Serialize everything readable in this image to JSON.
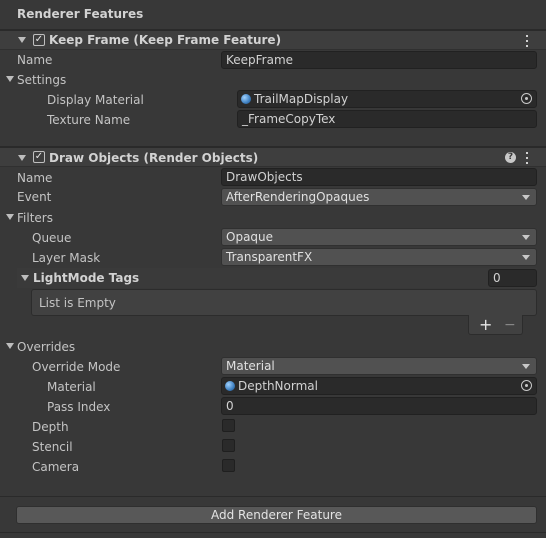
{
  "panel": {
    "title": "Renderer Features"
  },
  "keep_frame": {
    "title": "Keep Frame (Keep Frame Feature)",
    "enabled": true,
    "name_label": "Name",
    "name_value": "KeepFrame",
    "settings_label": "Settings",
    "display_material_label": "Display Material",
    "display_material_value": "TrailMapDisplay",
    "texture_name_label": "Texture Name",
    "texture_name_value": "_FrameCopyTex"
  },
  "draw_objects": {
    "title": "Draw Objects (Render Objects)",
    "enabled": true,
    "name_label": "Name",
    "name_value": "DrawObjects",
    "event_label": "Event",
    "event_value": "AfterRenderingOpaques",
    "filters_label": "Filters",
    "queue_label": "Queue",
    "queue_value": "Opaque",
    "layer_mask_label": "Layer Mask",
    "layer_mask_value": "TransparentFX",
    "lightmode_label": "LightMode Tags",
    "lightmode_count": "0",
    "list_empty": "List is Empty",
    "add_symbol": "+",
    "remove_symbol": "−",
    "overrides_label": "Overrides",
    "override_mode_label": "Override Mode",
    "override_mode_value": "Material",
    "material_label": "Material",
    "material_value": "DepthNormal",
    "pass_index_label": "Pass Index",
    "pass_index_value": "0",
    "depth_label": "Depth",
    "stencil_label": "Stencil",
    "camera_label": "Camera"
  },
  "footer": {
    "add_button": "Add Renderer Feature"
  },
  "colors": {
    "background": "#383838",
    "field": "#2a2a2a",
    "dropdown": "#515151",
    "object_icon": "#3e7fc0"
  }
}
